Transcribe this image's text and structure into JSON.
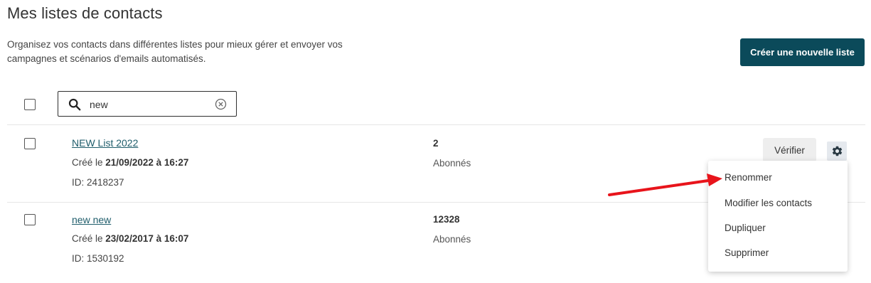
{
  "header": {
    "title": "Mes listes de contacts",
    "subtitle_line1": "Organisez vos contacts dans différentes listes pour mieux gérer et envoyer vos",
    "subtitle_line2": "campagnes et scénarios d'emails automatisés.",
    "create_button": "Créer une nouvelle liste"
  },
  "search": {
    "value": "new"
  },
  "lists": [
    {
      "name": "NEW List 2022",
      "created_prefix": "Créé le ",
      "created_date": "21/09/2022 à 16:27",
      "id_label": "ID: 2418237",
      "count": "2",
      "count_label": "Abonnés"
    },
    {
      "name": "new new",
      "created_prefix": "Créé le ",
      "created_date": "23/02/2017 à 16:07",
      "id_label": "ID: 1530192",
      "count": "12328",
      "count_label": "Abonnés"
    }
  ],
  "row_actions": {
    "verify_button": "Vérifier",
    "settings_icon": "gear-icon"
  },
  "dropdown": {
    "items": [
      "Renommer",
      "Modifier les contacts",
      "Dupliquer",
      "Supprimer"
    ]
  },
  "colors": {
    "primary": "#0b4a5a",
    "link": "#1f5d6b",
    "annotation_arrow": "#e8141b"
  }
}
